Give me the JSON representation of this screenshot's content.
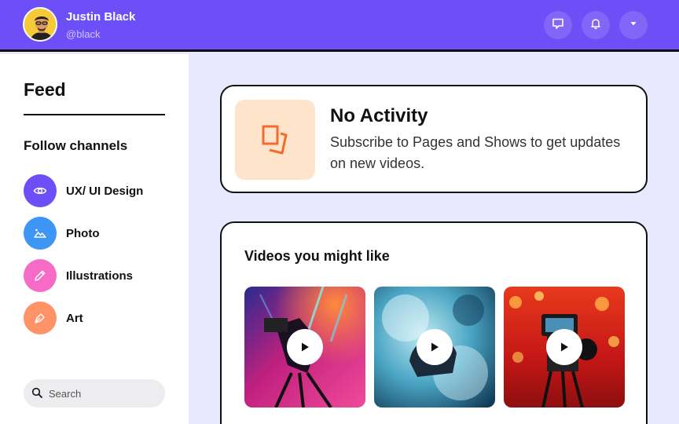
{
  "header": {
    "user_name": "Justin Black",
    "user_handle": "@black",
    "icons": [
      "chat-icon",
      "bell-icon",
      "chevron-down-icon"
    ]
  },
  "sidebar": {
    "feed_title": "Feed",
    "follow_title": "Follow channels",
    "channels": [
      {
        "label": "UX/ UI Design",
        "icon": "eye-icon",
        "color": "#6c4ff6"
      },
      {
        "label": "Photo",
        "icon": "mountain-icon",
        "color": "#3e96f4"
      },
      {
        "label": "Illustrations",
        "icon": "pencil-icon",
        "color": "#f56bc6"
      },
      {
        "label": "Art",
        "icon": "pen-nib-icon",
        "color": "#ff9267"
      }
    ],
    "search_placeholder": "Search"
  },
  "activity": {
    "title": "No Activity",
    "description": "Subscribe to Pages and Shows to get updates on new videos."
  },
  "videos": {
    "title": "Videos you might like",
    "items": [
      {
        "name": "video-camera-stage-lights",
        "icon": "play-icon"
      },
      {
        "name": "video-camera-smoke",
        "icon": "play-icon"
      },
      {
        "name": "video-camera-red-bokeh",
        "icon": "play-icon"
      }
    ]
  },
  "colors": {
    "accent": "#6c4ff6",
    "background": "#e8e8ff",
    "activity_icon_bg": "#ffe4cc",
    "activity_icon": "#f26a2e"
  }
}
